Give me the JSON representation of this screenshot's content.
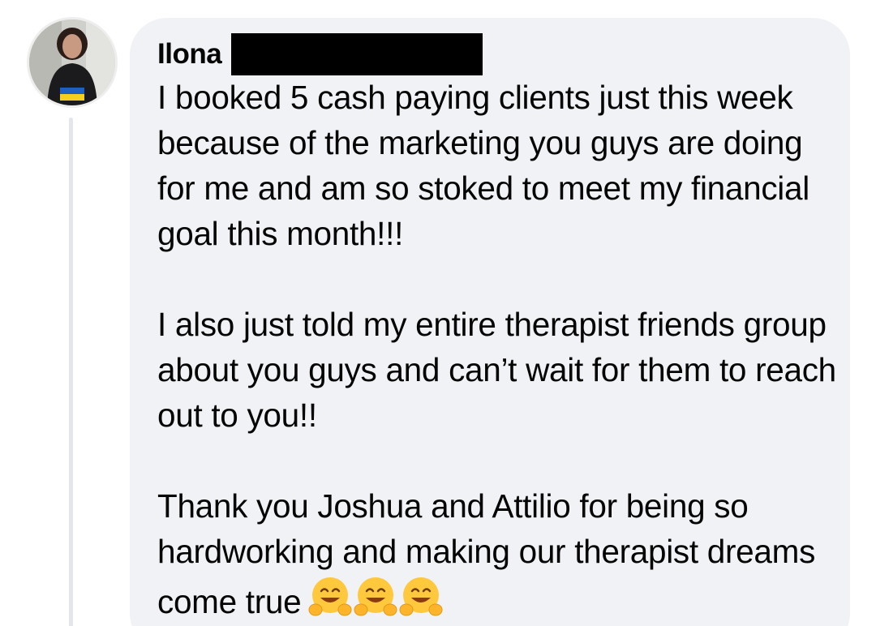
{
  "comment": {
    "author": "Ilona",
    "paragraphs": [
      "I booked 5 cash paying clients just this week because of the marketing you guys are doing for me and am so stoked to meet my financial goal this month!!!",
      "I also just told my entire therapist friends group about you guys and can’t wait for them to reach out to you!!",
      "Thank you Joshua and Attilio for being so hardworking and making our therapist dreams come true"
    ],
    "trailing_emojis": [
      "hugging-face-emoji",
      "hugging-face-emoji",
      "hugging-face-emoji"
    ]
  },
  "colors": {
    "bubble": "#f0f2f5",
    "text": "#050505",
    "thread_line": "#e4e6eb",
    "redaction": "#000000"
  }
}
